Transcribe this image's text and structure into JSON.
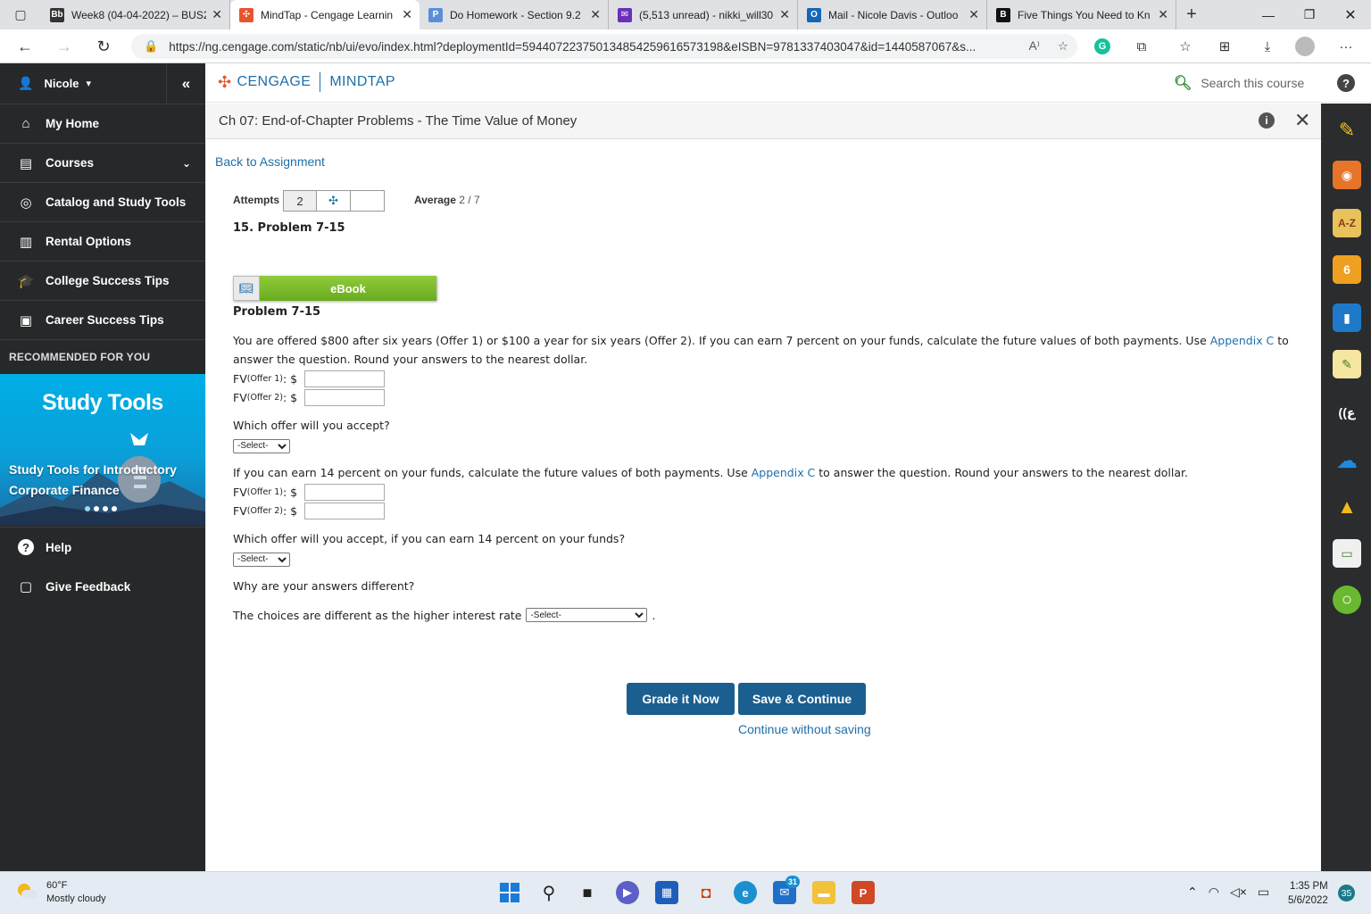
{
  "browser": {
    "tabs": [
      {
        "title": "Week8 (04-04-2022) – BUS2",
        "icon": "blackboard-icon",
        "color": "#333333",
        "glyph": "Bb"
      },
      {
        "title": "MindTap - Cengage Learnin",
        "icon": "cengage-icon",
        "color": "#e8542e",
        "glyph": "✣"
      },
      {
        "title": "Do Homework - Section 9.2",
        "icon": "pearson-icon",
        "color": "#5a8fd8",
        "glyph": "P"
      },
      {
        "title": "(5,513 unread) - nikki_will30",
        "icon": "yahoo-mail-icon",
        "color": "#6b2fb8",
        "glyph": "✉"
      },
      {
        "title": "Mail - Nicole Davis - Outloo",
        "icon": "outlook-icon",
        "color": "#1466b8",
        "glyph": "O"
      },
      {
        "title": "Five Things You Need to Kn",
        "icon": "bing-b-icon",
        "color": "#111111",
        "glyph": "B"
      }
    ],
    "url": "https://ng.cengage.com/static/nb/ui/evo/index.html?deploymentId=594407223750134854259616573198&eISBN=9781337403047&id=1440587067&s...",
    "read_aloud": "A⁾"
  },
  "sidebar": {
    "user": "Nicole",
    "items": [
      {
        "label": "My Home",
        "icon": "home-icon",
        "glyph": "⌂"
      },
      {
        "label": "Courses",
        "icon": "book-icon",
        "glyph": "▤"
      },
      {
        "label": "Catalog and Study Tools",
        "icon": "compass-icon",
        "glyph": "◎"
      },
      {
        "label": "Rental Options",
        "icon": "open-book-icon",
        "glyph": "▥"
      },
      {
        "label": "College Success Tips",
        "icon": "graduation-cap-icon",
        "glyph": "🎓"
      },
      {
        "label": "Career Success Tips",
        "icon": "briefcase-icon",
        "glyph": "▣"
      }
    ],
    "recommended_heading": "RECOMMENDED FOR YOU",
    "promo": {
      "title": "Study Tools",
      "desc": "Study Tools for Introductory Corporate Finance"
    },
    "bottom_items": [
      {
        "label": "Help",
        "icon": "help-circle-icon",
        "glyph": "?"
      },
      {
        "label": "Give Feedback",
        "icon": "feedback-icon",
        "glyph": "▢"
      }
    ]
  },
  "header": {
    "brand_left": "CENGAGE",
    "brand_right": "MINDTAP",
    "search_placeholder": "Search this course"
  },
  "activity": {
    "title": "Ch 07: End-of-Chapter Problems - The Time Value of Money"
  },
  "content": {
    "back_link": "Back to Assignment",
    "attempts_label": "Attempts",
    "attempts_value": "2",
    "average_label": "Average",
    "average_value": "2 / 7",
    "problem_heading": "15.  Problem 7-15",
    "ebook_label": "eBook",
    "problem_title": "Problem 7-15",
    "para1_a": "You are offered $800 after six years (Offer 1) or $100 a year for six years (Offer 2). If you can earn 7 percent on your funds, calculate the future values of both payments. Use ",
    "appendix_link": "Appendix C",
    "para1_b": " to answer the question. Round your answers to the nearest dollar.",
    "fv_prefix": "FV",
    "offer1_sub": "(Offer 1)",
    "offer2_sub": "(Offer 2)",
    "fv_suffix": ": $",
    "q_accept": "Which offer will you accept?",
    "select_default": "-Select-",
    "para2_a": "If you can earn 14 percent on your funds, calculate the future values of both payments. Use ",
    "para2_b": " to answer the question. Round your answers to the nearest dollar.",
    "q_accept14": "Which offer will you accept, if you can earn 14 percent on your funds?",
    "q_why": "Why are your answers different?",
    "choices_text": "The choices are different as the higher interest rate",
    "choices_end": ".",
    "grade_button": "Grade it Now",
    "save_button": "Save & Continue",
    "continue_link": "Continue without saving"
  },
  "dock": [
    {
      "icon": "highlighter-icon",
      "color": "#2a2c2e",
      "glyph": "✎"
    },
    {
      "icon": "rss-icon",
      "color": "#e8742a",
      "glyph": "◉"
    },
    {
      "icon": "glossary-az-icon",
      "color": "#e8c25a",
      "glyph": "A-Z"
    },
    {
      "icon": "cengage-orange-icon",
      "color": "#f0a020",
      "glyph": "6"
    },
    {
      "icon": "notebook-icon",
      "color": "#1e7ac8",
      "glyph": "▮"
    },
    {
      "icon": "notes-icon",
      "color": "#f5e6a0",
      "glyph": "✎"
    },
    {
      "icon": "readspeaker-icon",
      "color": "#2a2c2e",
      "glyph": "((ع"
    },
    {
      "icon": "onedrive-icon",
      "color": "#2a2c2e",
      "glyph": "☁"
    },
    {
      "icon": "google-drive-icon",
      "color": "#2a2c2e",
      "glyph": "▲"
    },
    {
      "icon": "flashcards-icon",
      "color": "#f0f0f0",
      "glyph": "▭"
    },
    {
      "icon": "progress-ring-icon",
      "color": "#6ab830",
      "glyph": "○"
    }
  ],
  "taskbar": {
    "temperature": "60°F",
    "weather": "Mostly cloudy",
    "mail_badge": "31",
    "time": "1:35 PM",
    "date": "5/6/2022",
    "notifications": "35"
  }
}
